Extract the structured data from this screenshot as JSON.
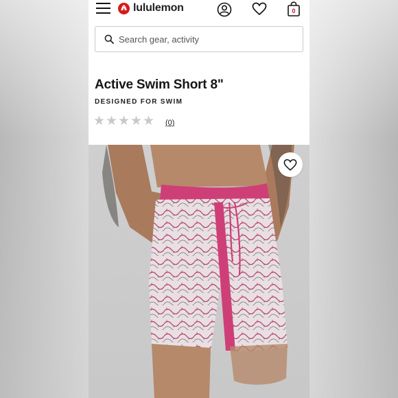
{
  "header": {
    "brand_name": "lululemon",
    "cart_count": "0",
    "icons": [
      "hamburger-menu-icon",
      "lululemon-logo-icon",
      "account-icon",
      "heart-icon",
      "shopping-bag-icon"
    ]
  },
  "search": {
    "placeholder": "Search gear, activity"
  },
  "product": {
    "title": "Active Swim Short 8\"",
    "category": "DESIGNED FOR SWIM",
    "rating": 0,
    "max_rating": 5,
    "stars": [
      "★",
      "★",
      "★",
      "★",
      "★"
    ],
    "review_count_label": "(0)"
  },
  "colors": {
    "brand_red": "#d31c1c",
    "star_empty": "#c9c9c9",
    "short_pink": "#cf3f77"
  }
}
